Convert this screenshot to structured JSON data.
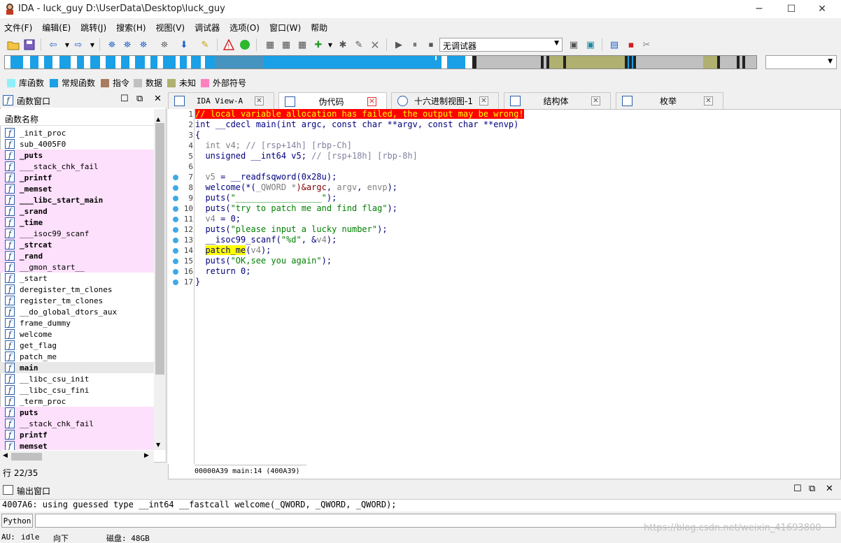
{
  "window": {
    "title": "IDA - luck_guy D:\\UserData\\Desktop\\luck_guy",
    "minimize": "─",
    "maximize": "☐",
    "close": "✕"
  },
  "menu": [
    "文件(F)",
    "编辑(E)",
    "跳转(J)",
    "搜索(H)",
    "视图(V)",
    "调试器",
    "选项(O)",
    "窗口(W)",
    "帮助"
  ],
  "toolbar": {
    "debugger": "无调试器"
  },
  "legend": [
    {
      "label": "库函数",
      "color": "#8ff0f8"
    },
    {
      "label": "常规函数",
      "color": "#1aa0e6"
    },
    {
      "label": "指令",
      "color": "#a87c60"
    },
    {
      "label": "数据",
      "color": "#c0c0c0"
    },
    {
      "label": "未知",
      "color": "#b0b070"
    },
    {
      "label": "外部符号",
      "color": "#ff80c0"
    }
  ],
  "funcwin": {
    "title": "函数窗口",
    "column": "函数名称",
    "status": "行 22/35",
    "items": [
      {
        "name": "_init_proc",
        "lib": false,
        "bold": false
      },
      {
        "name": "sub_4005F0",
        "lib": false,
        "bold": false
      },
      {
        "name": "_puts",
        "lib": true,
        "bold": true
      },
      {
        "name": "___stack_chk_fail",
        "lib": true,
        "bold": false
      },
      {
        "name": "_printf",
        "lib": true,
        "bold": true
      },
      {
        "name": "_memset",
        "lib": true,
        "bold": true
      },
      {
        "name": "___libc_start_main",
        "lib": true,
        "bold": true
      },
      {
        "name": "_srand",
        "lib": true,
        "bold": true
      },
      {
        "name": "_time",
        "lib": true,
        "bold": true
      },
      {
        "name": "___isoc99_scanf",
        "lib": true,
        "bold": false
      },
      {
        "name": "_strcat",
        "lib": true,
        "bold": true
      },
      {
        "name": "_rand",
        "lib": true,
        "bold": true
      },
      {
        "name": "__gmon_start__",
        "lib": true,
        "bold": false
      },
      {
        "name": "_start",
        "lib": false,
        "bold": false
      },
      {
        "name": "deregister_tm_clones",
        "lib": false,
        "bold": false
      },
      {
        "name": "register_tm_clones",
        "lib": false,
        "bold": false
      },
      {
        "name": "__do_global_dtors_aux",
        "lib": false,
        "bold": false
      },
      {
        "name": "frame_dummy",
        "lib": false,
        "bold": false
      },
      {
        "name": "welcome",
        "lib": false,
        "bold": false
      },
      {
        "name": "get_flag",
        "lib": false,
        "bold": false
      },
      {
        "name": "patch_me",
        "lib": false,
        "bold": false
      },
      {
        "name": "main",
        "lib": false,
        "bold": true,
        "sel": true
      },
      {
        "name": "__libc_csu_init",
        "lib": false,
        "bold": false
      },
      {
        "name": "__libc_csu_fini",
        "lib": false,
        "bold": false
      },
      {
        "name": "_term_proc",
        "lib": false,
        "bold": false
      },
      {
        "name": "puts",
        "lib": true,
        "bold": true
      },
      {
        "name": "__stack_chk_fail",
        "lib": true,
        "bold": false
      },
      {
        "name": "printf",
        "lib": true,
        "bold": true
      },
      {
        "name": "memset",
        "lib": true,
        "bold": true
      }
    ]
  },
  "tabs": [
    {
      "label": "IDA View-A",
      "active": false
    },
    {
      "label": "伪代码",
      "active": true
    },
    {
      "label": "十六进制视图-1",
      "active": false
    },
    {
      "label": "结构体",
      "active": false
    },
    {
      "label": "枚举",
      "active": false
    }
  ],
  "code": {
    "line_numbers": [
      "1",
      "2",
      "3",
      "4",
      "5",
      "6",
      "7",
      "8",
      "9",
      "10",
      "11",
      "12",
      "13",
      "14",
      "15",
      "16",
      "17"
    ],
    "l1": "// local variable allocation has failed, the output may be wrong!",
    "l2": "int __cdecl main(int argc, const char **argv, const char **envp)",
    "l3": "{",
    "l4a": "  int v4; ",
    "l4b": "// [rsp+14h] [rbp-Ch]",
    "l5a": "  unsigned __int64 v5; ",
    "l5b": "// [rsp+18h] [rbp-8h]",
    "l7a": "  v5",
    "l7b": " = __readfsqword(0x28u);",
    "l8a": "  welcome(*(",
    "l8b": "_QWORD *",
    "l8c": ")&argc",
    "l8d": ", ",
    "l8e": "argv",
    "l8f": ", ",
    "l8g": "envp",
    "l8h": ");",
    "l9a": "  puts(",
    "l9b": "\"_________________\"",
    "l9c": ");",
    "l10a": "  puts(",
    "l10b": "\"try to patch me and find flag\"",
    "l10c": ");",
    "l11a": "  v4",
    "l11b": " = 0;",
    "l12a": "  puts(",
    "l12b": "\"please input a lucky number\"",
    "l12c": ");",
    "l13a": "  __isoc99_scanf(",
    "l13b": "\"%d\"",
    "l13c": ", &",
    "l13d": "v4",
    "l13e": ");",
    "l14a": "  ",
    "l14b": "patch_me",
    "l14c": "(",
    "l14d": "v4",
    "l14e": ");",
    "l15a": "  puts(",
    "l15b": "\"OK,see you again\"",
    "l15c": ");",
    "l16": "  return 0;",
    "l17": "}",
    "status": "00000A39 main:14 (400A39)"
  },
  "output": {
    "title": "输出窗口",
    "line": "4007A6: using guessed type __int64 __fastcall welcome(_QWORD, _QWORD, _QWORD);",
    "python_label": "Python"
  },
  "statusbar": {
    "au": "AU:",
    "state": "idle",
    "dir": "向下",
    "disk": "磁盘: 48GB"
  },
  "watermark": "https://blog.csdn.net/weixin_41693800"
}
